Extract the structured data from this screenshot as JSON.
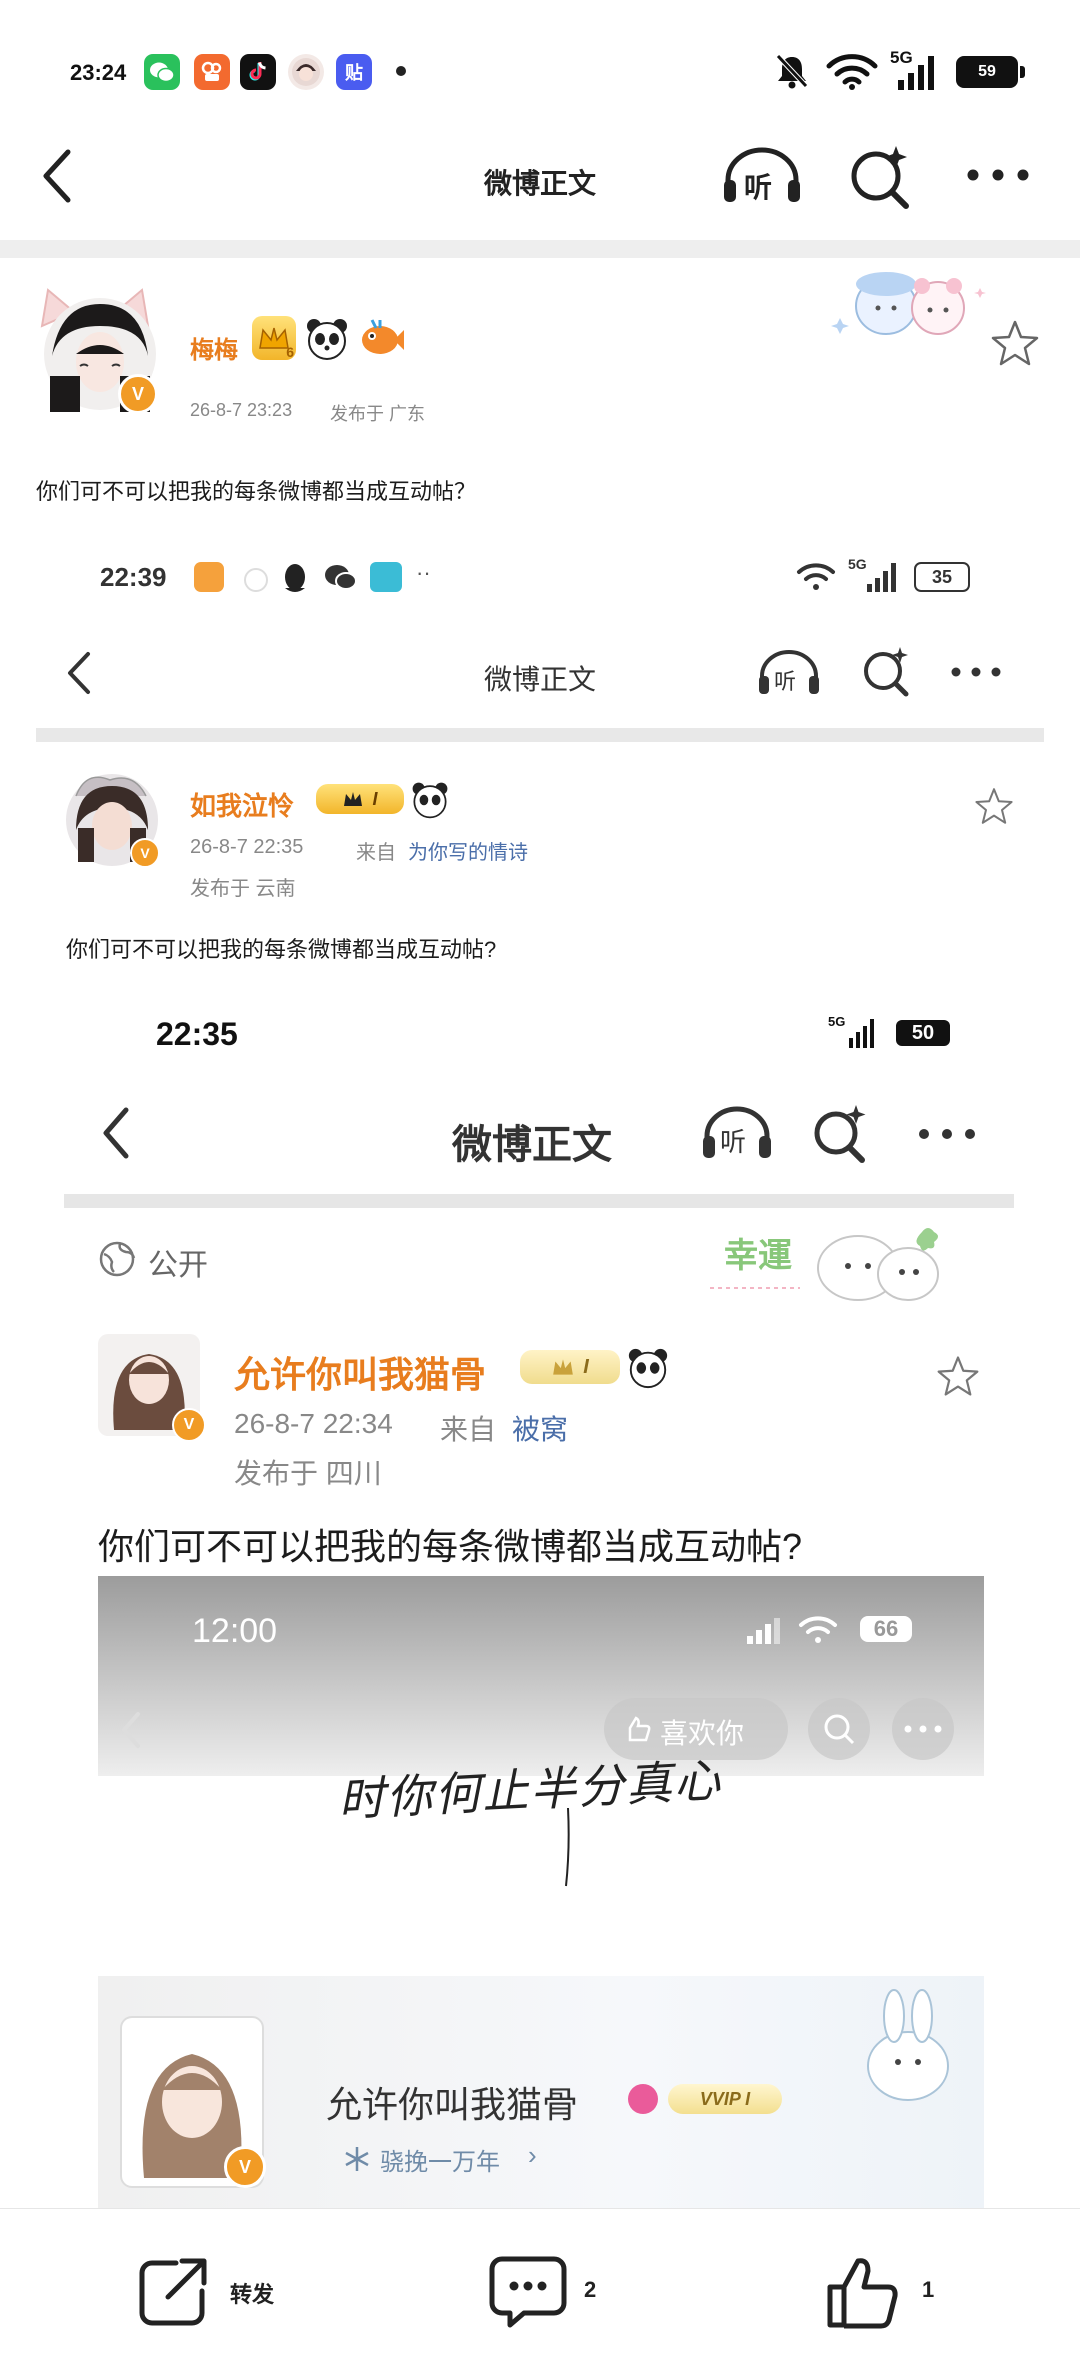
{
  "status": {
    "time": "23:24",
    "network": "5G",
    "battery": "59"
  },
  "nav": {
    "title": "微博正文",
    "listen": "听"
  },
  "post": {
    "author": "梅梅",
    "level": "6",
    "time": "26-8-7 23:23",
    "location": "发布于 广东",
    "text": "你们可不可以把我的每条微博都当成互动帖？"
  },
  "shot1": {
    "status": {
      "time": "22:39",
      "network": "5G",
      "battery": "35"
    },
    "nav": {
      "title": "微博正文",
      "listen": "听"
    },
    "post": {
      "author": "如我泣怜",
      "badge": "I",
      "time": "26-8-7 22:35",
      "from_label": "来自",
      "from_link": "为你写的情诗",
      "location": "发布于 云南",
      "text": "你们可不可以把我的每条微博都当成互动帖?"
    }
  },
  "shot2": {
    "status": {
      "time": "22:35",
      "network": "5G",
      "battery": "50"
    },
    "nav": {
      "title": "微博正文",
      "listen": "听"
    },
    "visibility": "公开",
    "sticker_text": "幸運",
    "post": {
      "author": "允许你叫我猫骨",
      "badge": "I",
      "time": "26-8-7 22:34",
      "from_label": "来自",
      "from_link": "被窝",
      "location": "发布于 四川",
      "text": "你们可不可以把我的每条微博都当成互动帖?"
    }
  },
  "shot3": {
    "status": {
      "time": "12:00",
      "battery": "66"
    },
    "like_label": "喜欢你",
    "handwriting": "时你何止半分真心",
    "profile": {
      "name": "允许你叫我猫骨",
      "vip": "VVIP I",
      "tagline": "骁挽一万年"
    }
  },
  "bottom": {
    "repost": "转发",
    "comments": "2",
    "likes": "1"
  },
  "colors": {
    "orange": "#e87d1e",
    "link": "#4a6ea9",
    "vbadge": "#f19b25"
  }
}
